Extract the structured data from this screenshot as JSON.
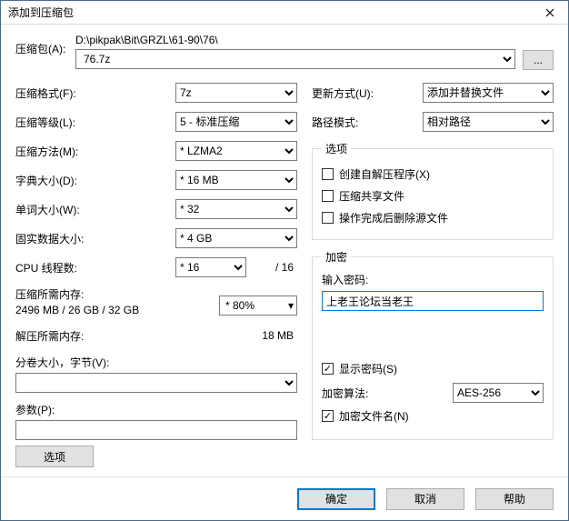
{
  "window": {
    "title": "添加到压缩包"
  },
  "archive": {
    "label": "压缩包(A):",
    "path": "D:\\pikpak\\Bit\\GRZL\\61-90\\76\\",
    "value": "76.7z",
    "browse": "..."
  },
  "left": {
    "format_label": "压缩格式(F):",
    "format": "7z",
    "level_label": "压缩等级(L):",
    "level": "5 - 标准压缩",
    "method_label": "压缩方法(M):",
    "method": "* LZMA2",
    "dict_label": "字典大小(D):",
    "dict": "* 16 MB",
    "word_label": "单词大小(W):",
    "word": "* 32",
    "solid_label": "固实数据大小:",
    "solid": "* 4 GB",
    "cpu_label": "CPU 线程数:",
    "cpu": "* 16",
    "cpu_total": "/ 16",
    "mem_comp_label": "压缩所需内存:",
    "mem_info_line": "2496 MB / 26 GB / 32 GB",
    "mem_pct": "* 80%",
    "mem_decomp_label": "解压所需内存:",
    "mem_decomp_value": "18 MB",
    "split_label": "分卷大小，字节(V):",
    "split_value": "",
    "params_label": "参数(P):",
    "params_value": "",
    "options_button": "选项"
  },
  "right": {
    "update_label": "更新方式(U):",
    "update": "添加并替换文件",
    "pathmode_label": "路径模式:",
    "pathmode": "相对路径",
    "options_legend": "选项",
    "opt_sfx": "创建自解压程序(X)",
    "opt_share": "压缩共享文件",
    "opt_delete": "操作完成后删除源文件",
    "enc_legend": "加密",
    "pw_label": "输入密码:",
    "pw_value": "上老王论坛当老王",
    "show_pw": "显示密码(S)",
    "algo_label": "加密算法:",
    "algo": "AES-256",
    "enc_names": "加密文件名(N)"
  },
  "footer": {
    "ok": "确定",
    "cancel": "取消",
    "help": "帮助"
  }
}
